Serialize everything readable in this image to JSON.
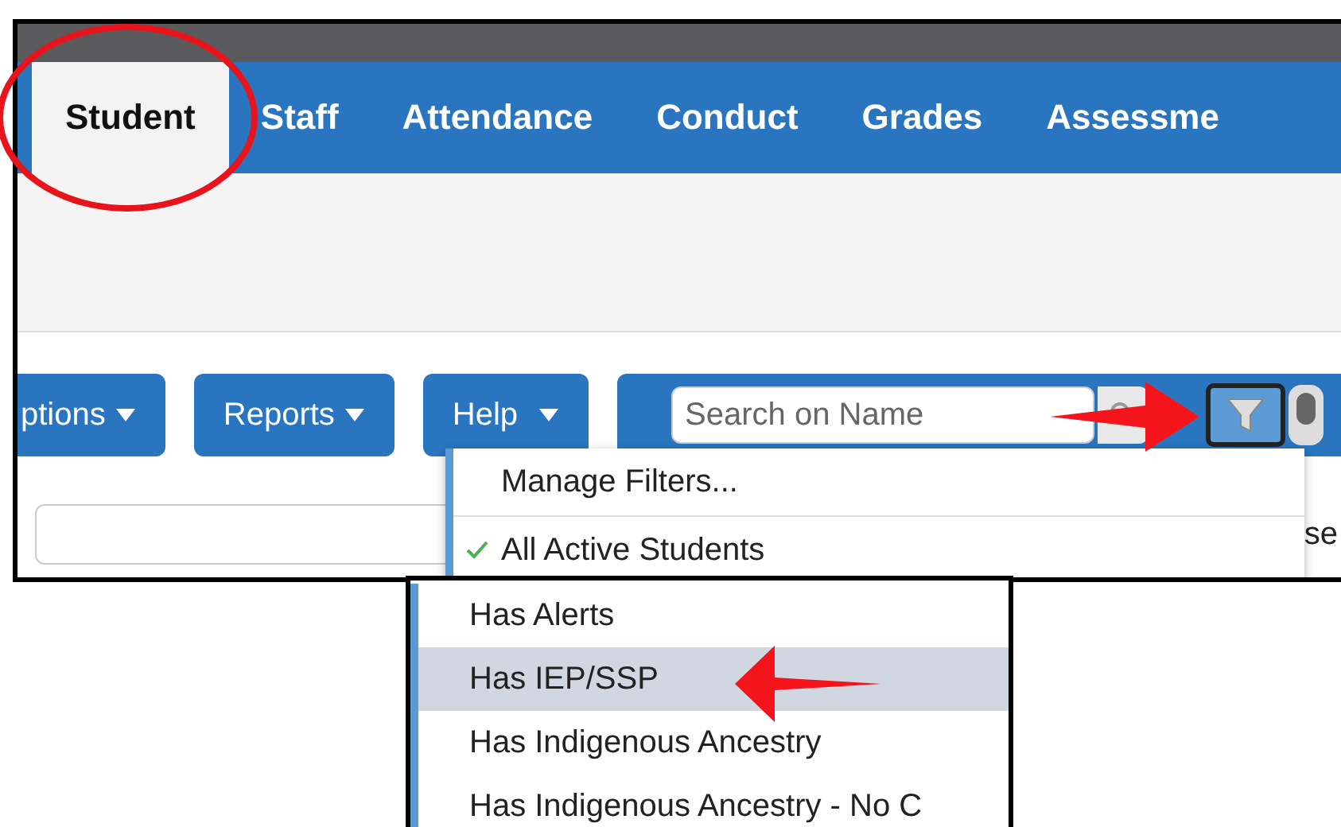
{
  "tabs": [
    {
      "label": "Student",
      "selected": true
    },
    {
      "label": "Staff",
      "selected": false
    },
    {
      "label": "Attendance",
      "selected": false
    },
    {
      "label": "Conduct",
      "selected": false
    },
    {
      "label": "Grades",
      "selected": false
    },
    {
      "label": "Assessme",
      "selected": false
    }
  ],
  "toolbar": {
    "buttons": [
      {
        "label": "ptions"
      },
      {
        "label": "Reports"
      },
      {
        "label": "Help"
      }
    ],
    "search": {
      "placeholder": "Search on Name"
    },
    "toggle": {
      "on": false
    }
  },
  "filter_menu": {
    "items": [
      {
        "label": "Manage Filters...",
        "checked": false
      },
      {
        "label": "All Active Students",
        "checked": true
      }
    ]
  },
  "result_count": "se",
  "filter_list": {
    "items": [
      {
        "label": "Has Alerts",
        "selected": false
      },
      {
        "label": "Has IEP/SSP",
        "selected": true
      },
      {
        "label": "Has Indigenous Ancestry",
        "selected": false
      },
      {
        "label": "Has Indigenous Ancestry - No C",
        "selected": false
      }
    ]
  }
}
